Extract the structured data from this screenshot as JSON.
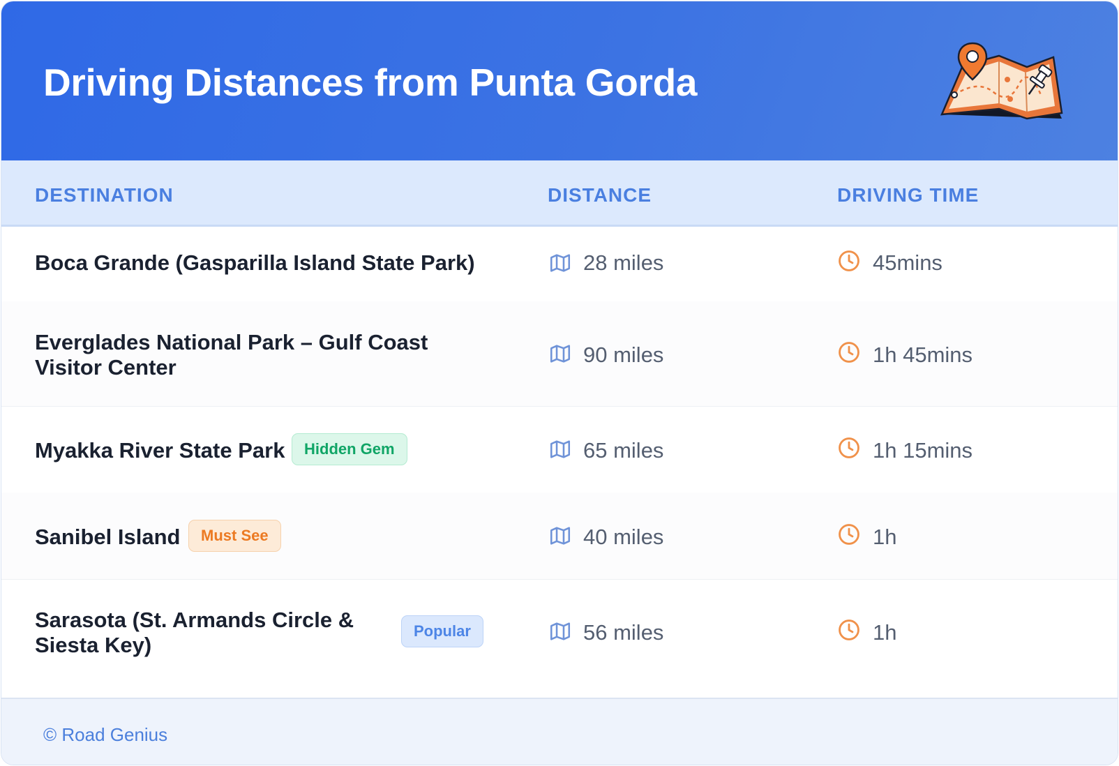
{
  "header": {
    "title": "Driving Distances from Punta Gorda",
    "illustration": "map-with-location-pin-icon"
  },
  "columns": {
    "destination": "DESTINATION",
    "distance": "DISTANCE",
    "driving_time": "DRIVING TIME"
  },
  "rows": [
    {
      "destination_line1": "Boca Grande (Gasparilla Island State Park)",
      "destination_line2": "",
      "badge": "",
      "distance": "28 miles",
      "time": "45mins"
    },
    {
      "destination_line1": "Everglades National Park – Gulf Coast",
      "destination_line2": "Visitor Center",
      "badge": "",
      "distance": "90 miles",
      "time": "1h 45mins"
    },
    {
      "destination_line1": "Myakka River State Park",
      "destination_line2": "",
      "badge": "Hidden Gem",
      "distance": "65 miles",
      "time": "1h 15mins"
    },
    {
      "destination_line1": "Sanibel Island",
      "destination_line2": "",
      "badge": "Must See",
      "distance": "40 miles",
      "time": "1h"
    },
    {
      "destination_line1": "Sarasota (St. Armands Circle &",
      "destination_line2": "Siesta Key)",
      "badge": "Popular",
      "distance": "56 miles",
      "time": "1h"
    }
  ],
  "icons": {
    "distance": "map-icon",
    "time": "clock-icon"
  },
  "colors": {
    "header_gradient_start": "#2f69e6",
    "header_gradient_end": "#4d81e1",
    "column_header_text": "#4a7fe0",
    "hidden_gem_badge": "#10a566",
    "must_see_badge": "#ec7a22",
    "popular_badge": "#4d85e6",
    "clock_icon": "#f0914a",
    "map_icon": "#6f93d8"
  },
  "footer": {
    "copyright": "© Road Genius"
  }
}
